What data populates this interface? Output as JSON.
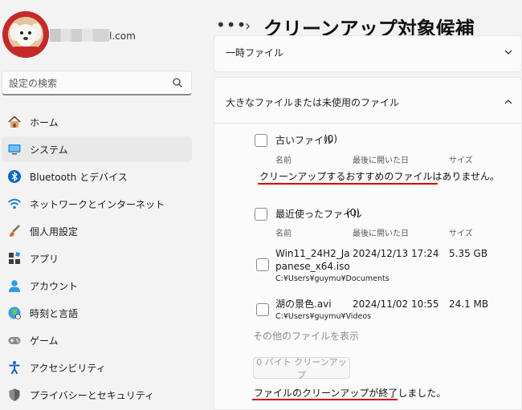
{
  "sidebar": {
    "account_email_suffix": "l.com",
    "search_placeholder": "設定の検索",
    "items": [
      {
        "label": "ホーム",
        "icon": "home-icon"
      },
      {
        "label": "システム",
        "icon": "system-icon",
        "active": true
      },
      {
        "label": "Bluetooth とデバイス",
        "icon": "bluetooth-icon"
      },
      {
        "label": "ネットワークとインターネット",
        "icon": "wifi-icon"
      },
      {
        "label": "個人用設定",
        "icon": "brush-icon"
      },
      {
        "label": "アプリ",
        "icon": "apps-icon"
      },
      {
        "label": "アカウント",
        "icon": "account-icon"
      },
      {
        "label": "時刻と言語",
        "icon": "globe-icon"
      },
      {
        "label": "ゲーム",
        "icon": "gamepad-icon"
      },
      {
        "label": "アクセシビリティ",
        "icon": "accessibility-icon"
      },
      {
        "label": "プライバシーとセキュリティ",
        "icon": "shield-icon"
      }
    ]
  },
  "header": {
    "ellipsis": "•••",
    "separator": "›",
    "title": "クリーンアップ対象候補"
  },
  "panels": {
    "temp_files_label": "一時ファイル",
    "large_unused_label": "大きなファイルまたは未使用のファイル"
  },
  "old_files": {
    "title": "古いファイル",
    "count": "(0)",
    "col_name": "名前",
    "col_last_opened": "最後に開いた日",
    "col_size": "サイズ",
    "empty_message": "クリーンアップするおすすめのファイルはありません。"
  },
  "recent_files": {
    "title": "最近使ったファイル",
    "count": "(0)",
    "col_name": "名前",
    "col_last_opened": "最後に開いた日",
    "col_size": "サイズ",
    "files": [
      {
        "name_line1": "Win11_24H2_Ja",
        "name_line2": "panese_x64.iso",
        "path": "C:¥Users¥guymu¥Documents",
        "date": "2024/12/13 17:24",
        "size": "5.35 GB"
      },
      {
        "name_line1": "湖の景色.avi",
        "path": "C:¥Users¥guymu¥Videos",
        "date": "2024/11/02 10:55",
        "size": "24.1 MB"
      }
    ]
  },
  "more_files_link": "その他のファイルを表示",
  "cleanup_button": "0 バイト クリーンアップ",
  "done_message": "ファイルのクリーンアップが終了しました。",
  "colors": {
    "accent": "#0067c0",
    "annotation_red": "#d60000"
  }
}
